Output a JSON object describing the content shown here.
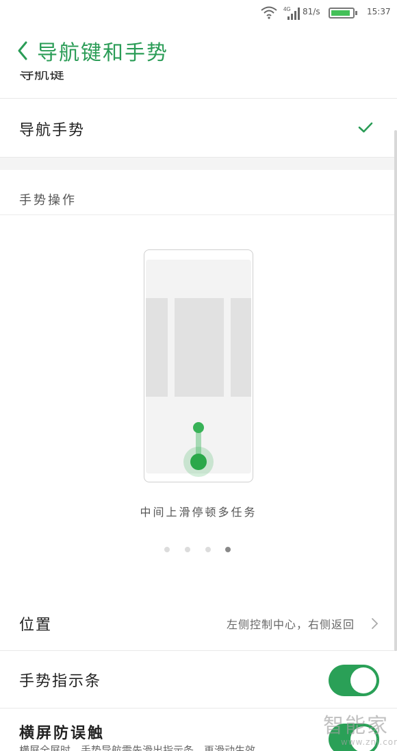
{
  "status_bar": {
    "network": "4G",
    "speed": "81/s",
    "time": "15:37",
    "battery_level": 0.9,
    "accent": "#44c058"
  },
  "header": {
    "title": "导航键和手势",
    "back_icon": "chevron-left-icon",
    "title_color": "#2a9c56"
  },
  "nav_options": {
    "partial_label": "导航键",
    "gesture_label": "导航手势",
    "gesture_selected": true
  },
  "gesture_section": {
    "header": "手势操作",
    "caption": "中间上滑停顿多任务",
    "pages_total": 4,
    "page_active": 4
  },
  "settings": {
    "position_label": "位置",
    "position_value": "左侧控制中心，右侧返回",
    "indicator_label": "手势指示条",
    "indicator_enabled": true,
    "landscape_label": "横屏防误触",
    "landscape_desc": "横屏全屏时，手势导航需先滑出指示条，再滑动生效",
    "landscape_enabled": true,
    "toggle_color": "#2aa057"
  },
  "watermark": {
    "logo": "智能家",
    "url": "www.znj.com"
  }
}
